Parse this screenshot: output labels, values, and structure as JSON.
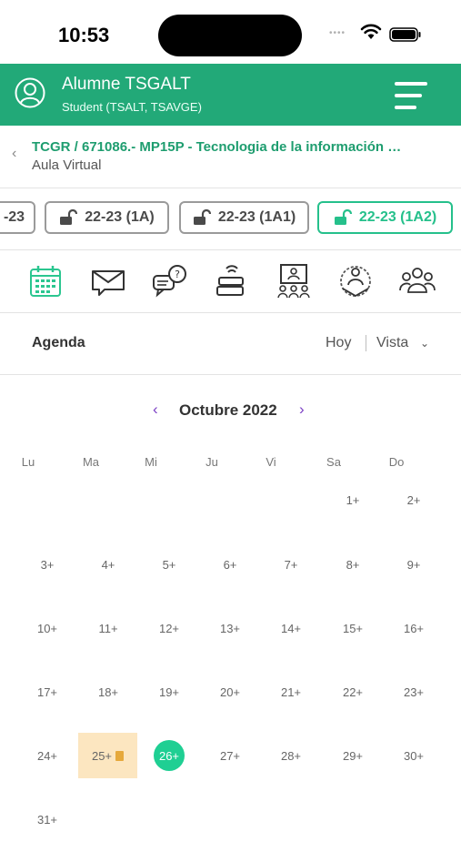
{
  "status_bar": {
    "time": "10:53",
    "signal_dots": "••••"
  },
  "header": {
    "name": "Alumne TSGALT",
    "role": "Student (TSALT, TSAVGE)"
  },
  "breadcrumb": {
    "course": "TCGR / 671086.- MP15P - Tecnologia de la información …",
    "subtitle": "Aula Virtual"
  },
  "groups": [
    {
      "label": "-23",
      "locked": false,
      "active": false
    },
    {
      "label": "22-23 (1A)",
      "locked": false,
      "active": false
    },
    {
      "label": "22-23 (1A1)",
      "locked": false,
      "active": false
    },
    {
      "label": "22-23 (1A2)",
      "locked": false,
      "active": true
    }
  ],
  "tools": [
    "calendar-icon",
    "mail-icon",
    "forum-icon",
    "books-icon",
    "classroom-icon",
    "teacher-icon",
    "group-icon"
  ],
  "agenda": {
    "title": "Agenda",
    "today": "Hoy",
    "view": "Vista"
  },
  "calendar": {
    "month": "Octubre 2022",
    "weekdays": [
      "Lu",
      "Ma",
      "Mi",
      "Ju",
      "Vi",
      "Sa",
      "Do"
    ],
    "weeks": [
      [
        "",
        "",
        "",
        "",
        "",
        "1+",
        "2+"
      ],
      [
        "3+",
        "4+",
        "5+",
        "6+",
        "7+",
        "8+",
        "9+"
      ],
      [
        "10+",
        "11+",
        "12+",
        "13+",
        "14+",
        "15+",
        "16+"
      ],
      [
        "17+",
        "18+",
        "19+",
        "20+",
        "21+",
        "22+",
        "23+"
      ],
      [
        "24+",
        "25+",
        "26+",
        "27+",
        "28+",
        "29+",
        "30+"
      ],
      [
        "31+",
        "",
        "",
        "",
        "",
        "",
        ""
      ]
    ],
    "today": "26+",
    "event_day": "25+"
  },
  "colors": {
    "primary": "#22a978",
    "accent": "#25c08b",
    "nav": "#7b3fc4",
    "event_bg": "#fce6c0"
  }
}
